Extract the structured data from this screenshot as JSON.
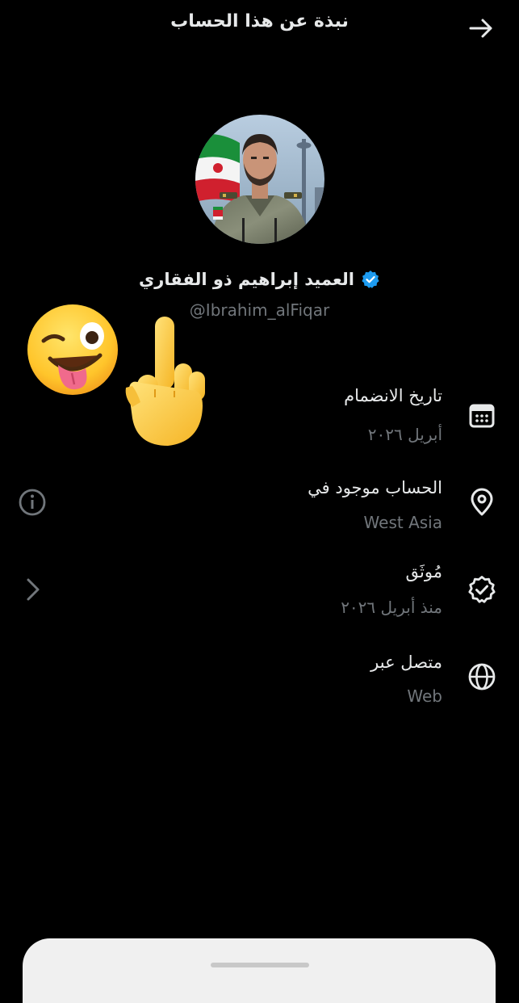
{
  "header": {
    "title": "نبذة عن هذا الحساب"
  },
  "profile": {
    "display_name": "العميد إبراهيم ذو الفقاري",
    "handle": "@Ibrahim_alFiqar",
    "verified_color": "#1d9bf0"
  },
  "details": [
    {
      "label": "تاريخ الانضمام",
      "value": "أبريل ٢٠٢٦",
      "icon": "calendar-icon"
    },
    {
      "label": "الحساب موجود في",
      "value": "West Asia",
      "icon": "location-pin-icon"
    },
    {
      "label": "مُوثَق",
      "value": "منذ أبريل ٢٠٢٦",
      "icon": "verified-badge-icon"
    },
    {
      "label": "متصل عبر",
      "value": "Web",
      "icon": "globe-icon"
    }
  ],
  "colors": {
    "background": "#000000",
    "primary_text": "#e7e9ea",
    "secondary_text": "#71767b",
    "sheet": "#f0f0f0"
  }
}
